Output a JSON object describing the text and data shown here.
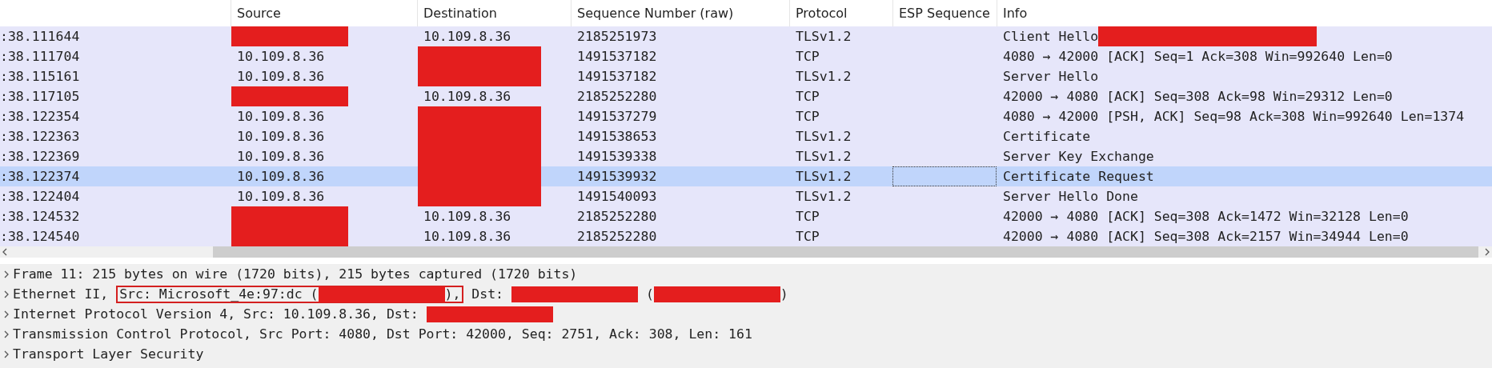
{
  "packet_list": {
    "columns": [
      "",
      "Source",
      "Destination",
      "Sequence Number (raw)",
      "Protocol",
      "ESP Sequence",
      "Info"
    ],
    "rows": [
      {
        "selected": false,
        "cells": [
          {
            "kind": "text",
            "text": ":38.111644"
          },
          {
            "kind": "redacted"
          },
          {
            "kind": "text",
            "text": "10.109.8.36"
          },
          {
            "kind": "text",
            "text": "2185251973"
          },
          {
            "kind": "text",
            "text": "TLSv1.2"
          },
          {
            "kind": "blank"
          },
          {
            "kind": "text_redacted",
            "text": "Client Hello "
          }
        ]
      },
      {
        "selected": false,
        "cells": [
          {
            "kind": "text",
            "text": ":38.111704"
          },
          {
            "kind": "text",
            "text": "10.109.8.36"
          },
          {
            "kind": "redacted"
          },
          {
            "kind": "text",
            "text": "1491537182"
          },
          {
            "kind": "text",
            "text": "TCP"
          },
          {
            "kind": "blank"
          },
          {
            "kind": "text",
            "text": "4080 → 42000 [ACK] Seq=1 Ack=308 Win=992640 Len=0"
          }
        ]
      },
      {
        "selected": false,
        "cells": [
          {
            "kind": "text",
            "text": ":38.115161"
          },
          {
            "kind": "text",
            "text": "10.109.8.36"
          },
          {
            "kind": "redacted"
          },
          {
            "kind": "text",
            "text": "1491537182"
          },
          {
            "kind": "text",
            "text": "TLSv1.2"
          },
          {
            "kind": "blank"
          },
          {
            "kind": "text",
            "text": "Server Hello"
          }
        ]
      },
      {
        "selected": false,
        "cells": [
          {
            "kind": "text",
            "text": ":38.117105"
          },
          {
            "kind": "redacted"
          },
          {
            "kind": "text",
            "text": "10.109.8.36"
          },
          {
            "kind": "text",
            "text": "2185252280"
          },
          {
            "kind": "text",
            "text": "TCP"
          },
          {
            "kind": "blank"
          },
          {
            "kind": "text",
            "text": "42000 → 4080 [ACK] Seq=308 Ack=98 Win=29312 Len=0"
          }
        ]
      },
      {
        "selected": false,
        "cells": [
          {
            "kind": "text",
            "text": ":38.122354"
          },
          {
            "kind": "text",
            "text": "10.109.8.36"
          },
          {
            "kind": "redacted"
          },
          {
            "kind": "text",
            "text": "1491537279"
          },
          {
            "kind": "text",
            "text": "TCP"
          },
          {
            "kind": "blank"
          },
          {
            "kind": "text",
            "text": "4080 → 42000 [PSH, ACK] Seq=98 Ack=308 Win=992640 Len=1374"
          }
        ]
      },
      {
        "selected": false,
        "cells": [
          {
            "kind": "text",
            "text": ":38.122363"
          },
          {
            "kind": "text",
            "text": "10.109.8.36"
          },
          {
            "kind": "redacted"
          },
          {
            "kind": "text",
            "text": "1491538653"
          },
          {
            "kind": "text",
            "text": "TLSv1.2"
          },
          {
            "kind": "blank"
          },
          {
            "kind": "text",
            "text": "Certificate"
          }
        ]
      },
      {
        "selected": false,
        "cells": [
          {
            "kind": "text",
            "text": ":38.122369"
          },
          {
            "kind": "text",
            "text": "10.109.8.36"
          },
          {
            "kind": "redacted"
          },
          {
            "kind": "text",
            "text": "1491539338"
          },
          {
            "kind": "text",
            "text": "TLSv1.2"
          },
          {
            "kind": "blank"
          },
          {
            "kind": "text",
            "text": "Server Key Exchange"
          }
        ]
      },
      {
        "selected": true,
        "cells": [
          {
            "kind": "text",
            "text": ":38.122374"
          },
          {
            "kind": "text",
            "text": "10.109.8.36"
          },
          {
            "kind": "redacted"
          },
          {
            "kind": "text",
            "text": "1491539932"
          },
          {
            "kind": "text",
            "text": "TLSv1.2"
          },
          {
            "kind": "focus"
          },
          {
            "kind": "text",
            "text": "Certificate Request"
          }
        ]
      },
      {
        "selected": false,
        "cells": [
          {
            "kind": "text",
            "text": ":38.122404"
          },
          {
            "kind": "text",
            "text": "10.109.8.36"
          },
          {
            "kind": "redacted"
          },
          {
            "kind": "text",
            "text": "1491540093"
          },
          {
            "kind": "text",
            "text": "TLSv1.2"
          },
          {
            "kind": "blank"
          },
          {
            "kind": "text",
            "text": "Server Hello Done"
          }
        ]
      },
      {
        "selected": false,
        "cells": [
          {
            "kind": "text",
            "text": ":38.124532"
          },
          {
            "kind": "redacted"
          },
          {
            "kind": "text",
            "text": "10.109.8.36"
          },
          {
            "kind": "text",
            "text": "2185252280"
          },
          {
            "kind": "text",
            "text": "TCP"
          },
          {
            "kind": "blank"
          },
          {
            "kind": "text",
            "text": "42000 → 4080 [ACK] Seq=308 Ack=1472 Win=32128 Len=0"
          }
        ]
      },
      {
        "selected": false,
        "cells": [
          {
            "kind": "text",
            "text": ":38.124540"
          },
          {
            "kind": "redacted"
          },
          {
            "kind": "text",
            "text": "10.109.8.36"
          },
          {
            "kind": "text",
            "text": "2185252280"
          },
          {
            "kind": "text",
            "text": "TCP"
          },
          {
            "kind": "blank"
          },
          {
            "kind": "text",
            "text": "42000 → 4080 [ACK] Seq=308 Ack=2157 Win=34944 Len=0"
          }
        ]
      }
    ]
  },
  "packet_details": [
    {
      "expanded": false,
      "segments": [
        {
          "kind": "text",
          "text": "Frame 11: 215 bytes on wire (1720 bits), 215 bytes captured (1720 bits)"
        }
      ]
    },
    {
      "expanded": false,
      "segments": [
        {
          "kind": "text",
          "text": "Ethernet II, "
        },
        {
          "kind": "frame",
          "children": [
            {
              "kind": "text",
              "text": "Src: Microsoft_4e:97:dc ("
            },
            {
              "kind": "redaction"
            },
            {
              "kind": "text",
              "text": "),"
            }
          ]
        },
        {
          "kind": "text",
          "text": " Dst: "
        },
        {
          "kind": "redaction"
        },
        {
          "kind": "text",
          "text": " ("
        },
        {
          "kind": "redaction"
        },
        {
          "kind": "text",
          "text": ")"
        }
      ]
    },
    {
      "expanded": false,
      "segments": [
        {
          "kind": "text",
          "text": "Internet Protocol Version 4, Src: 10.109.8.36, Dst: "
        },
        {
          "kind": "redaction"
        }
      ]
    },
    {
      "expanded": false,
      "segments": [
        {
          "kind": "text",
          "text": "Transmission Control Protocol, Src Port: 4080, Dst Port: 42000, Seq: 2751, Ack: 308, Len: 161"
        }
      ]
    },
    {
      "expanded": false,
      "segments": [
        {
          "kind": "text",
          "text": "Transport Layer Security"
        }
      ]
    }
  ]
}
